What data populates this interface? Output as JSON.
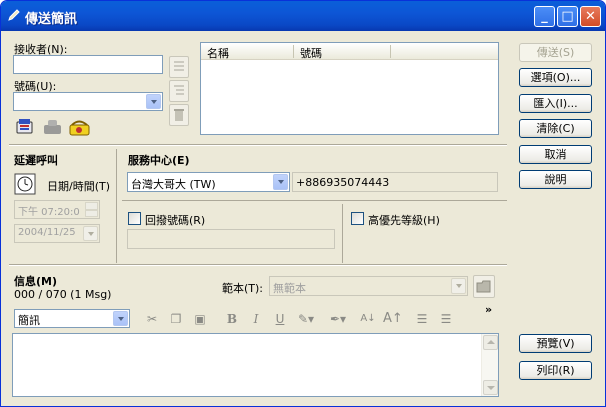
{
  "window": {
    "title": "傳送簡訊",
    "min": "_",
    "max": "□",
    "close": "✕"
  },
  "recipient": {
    "name_label": "接收者(N):",
    "number_label": "號碼(U):",
    "name_value": "",
    "number_value": ""
  },
  "list": {
    "col_name": "名稱",
    "col_number": "號碼"
  },
  "buttons": {
    "send": "傳送(S)",
    "options": "選項(O)...",
    "import": "匯入(I)...",
    "clear": "清除(C)",
    "cancel": "取消",
    "help": "說明",
    "preview": "預覽(V)",
    "print": "列印(R)"
  },
  "delay": {
    "heading": "延遲呼叫",
    "datetime_label": "日期/時間(T)",
    "time_value": "下午 07:20:0",
    "date_value": "2004/11/25"
  },
  "service": {
    "heading": "服務中心(E)",
    "carrier": "台灣大哥大 (TW)",
    "number": "+886935074443",
    "callback_label": "回撥號碼(R)",
    "priority_label": "高優先等級(H)",
    "callback_value": ""
  },
  "message": {
    "heading": "信息(M)",
    "counter": "000 / 070 (1 Msg)",
    "template_label": "範本(T):",
    "template_value": "無範本",
    "font_value": "簡訊",
    "more": "»",
    "body": ""
  },
  "colors": {
    "title_bar": "#0a5fd9",
    "dialog_bg": "#ece9d8",
    "accent_border": "#003c74"
  }
}
